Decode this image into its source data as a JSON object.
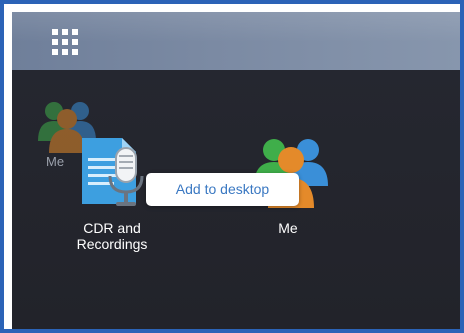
{
  "topbar": {
    "apps_icon": "grid-icon"
  },
  "desktop": {
    "ghost_icon_label": "Me",
    "icons": [
      {
        "label": "CDR and\nRecordings",
        "icon": "recordings-icon"
      },
      {
        "label": "Me",
        "icon": "user-group-icon"
      }
    ]
  },
  "context_menu": {
    "add_to_desktop": "Add to desktop"
  },
  "colors": {
    "accent": "#2b63b7",
    "menu_text": "#3a78c2",
    "desktop_bg": "#262831",
    "topbar": "#7b8aa3"
  }
}
